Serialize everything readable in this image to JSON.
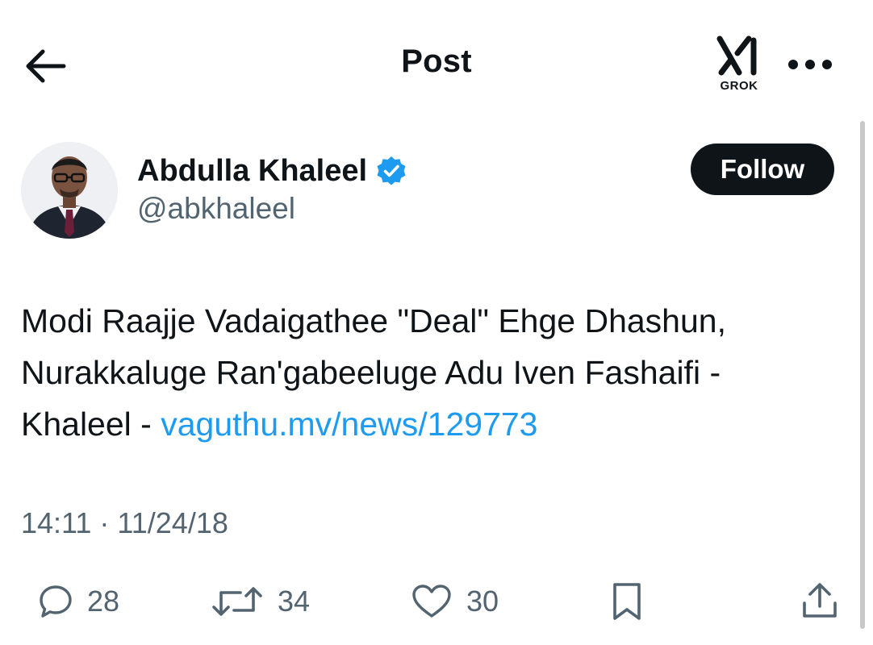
{
  "header": {
    "title": "Post",
    "grok_label": "GROK",
    "back_icon": "arrow-left-icon",
    "more_icon": "more-horizontal-icon"
  },
  "author": {
    "name": "Abdulla Khaleel",
    "handle": "@abkhaleel",
    "verified": true,
    "follow_label": "Follow"
  },
  "tweet": {
    "text_line1": "Modi Raajje Vadaigathee \"Deal\" Ehge Dhashun,",
    "text_line2": "Nurakkaluge Ran'gabeeluge Adu Iven Fashaifi -",
    "text_line3_prefix": "Khaleel - ",
    "link": "vaguthu.mv/news/129773",
    "timestamp": "14:11 · 11/24/18"
  },
  "actions": {
    "replies": "28",
    "reposts": "34",
    "likes": "30"
  },
  "colors": {
    "text": "#0f1419",
    "secondary": "#536471",
    "link": "#1d9bf0",
    "verified": "#1d9bf0",
    "button_bg": "#0f1419"
  }
}
